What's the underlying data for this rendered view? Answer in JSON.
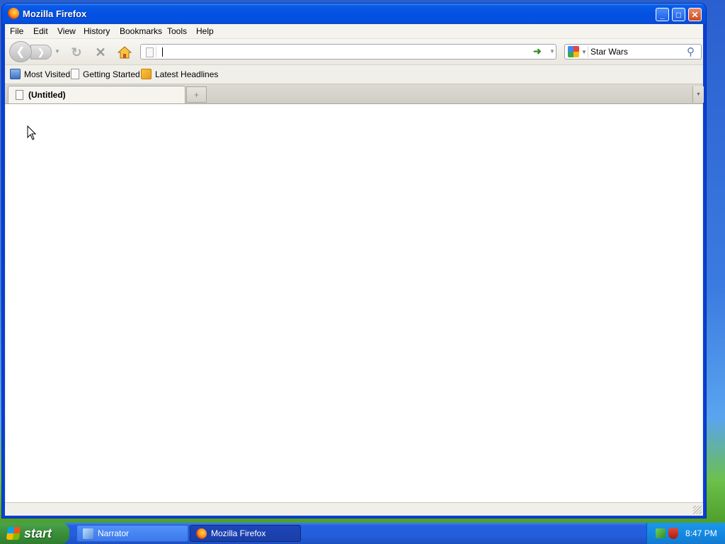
{
  "window": {
    "title": "Mozilla Firefox",
    "minimize_symbol": "_",
    "maximize_symbol": "□",
    "close_symbol": "✕"
  },
  "menubar": {
    "items": [
      {
        "label": "File"
      },
      {
        "label": "Edit"
      },
      {
        "label": "View"
      },
      {
        "label": "History"
      },
      {
        "label": "Bookmarks"
      },
      {
        "label": "Tools"
      },
      {
        "label": "Help"
      }
    ]
  },
  "navbar": {
    "url_value": "",
    "search_engine": "Google",
    "search_value": "Star Wars"
  },
  "bookmarks": {
    "items": [
      {
        "label": "Most Visited",
        "icon": "most-visited-icon"
      },
      {
        "label": "Getting Started",
        "icon": "page-icon"
      },
      {
        "label": "Latest Headlines",
        "icon": "rss-icon"
      }
    ]
  },
  "tabs": {
    "items": [
      {
        "label": "(Untitled)",
        "active": true
      }
    ]
  },
  "taskbar": {
    "start_label": "start",
    "tasks": [
      {
        "label": "Narrator",
        "active": false
      },
      {
        "label": "Mozilla Firefox",
        "active": true
      }
    ],
    "clock": "8:47 PM"
  },
  "colors": {
    "titlebar": "#0351e0",
    "taskbar": "#245edb",
    "start_button": "#3a8f3a",
    "tray": "#1487e0"
  }
}
